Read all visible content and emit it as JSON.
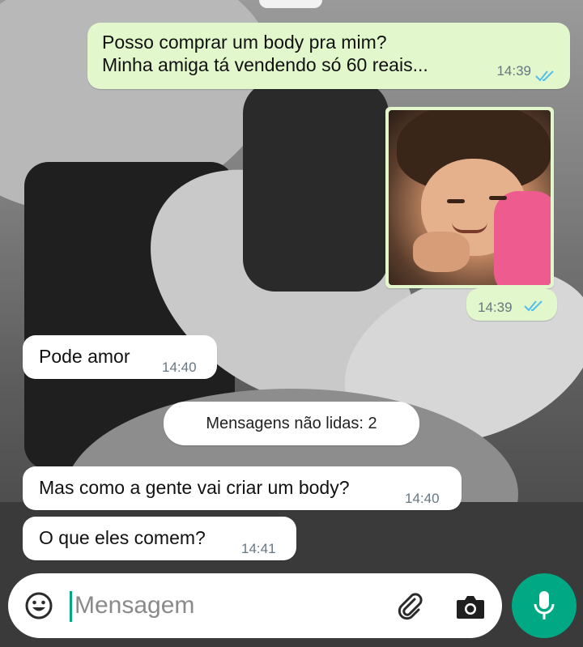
{
  "messages": {
    "outgoing_1": {
      "text": "Posso comprar um body pra mim?\nMinha amiga tá vendendo só 60 reais...",
      "time": "14:39",
      "status_icon": "double-check-read-icon"
    },
    "outgoing_image": {
      "time": "14:39",
      "status_icon": "double-check-read-icon"
    },
    "incoming_1": {
      "text": "Pode amor",
      "time": "14:40"
    },
    "unread_divider": "Mensagens não lidas: 2",
    "incoming_2": {
      "text": "Mas como a gente vai criar um body?",
      "time": "14:40"
    },
    "incoming_3": {
      "text": "O que eles comem?",
      "time": "14:41"
    }
  },
  "composer": {
    "placeholder": "Mensagem",
    "icons": [
      "emoji-icon",
      "paperclip-icon",
      "camera-icon",
      "mic-icon"
    ]
  },
  "colors": {
    "outgoing_bubble": "#e2f7cb",
    "incoming_bubble": "#ffffff",
    "accent": "#00a884",
    "read_ticks": "#53bdeb"
  }
}
